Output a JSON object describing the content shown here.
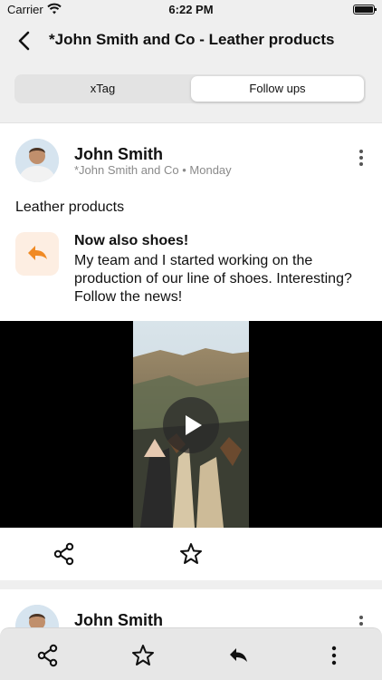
{
  "status_bar": {
    "carrier": "Carrier",
    "time": "6:22 PM"
  },
  "nav": {
    "title": "*John Smith and Co - Leather products"
  },
  "segments": [
    {
      "label": "xTag",
      "selected": false
    },
    {
      "label": "Follow ups",
      "selected": true
    }
  ],
  "post": {
    "author": "John Smith",
    "company": "*John Smith and Co",
    "day": "Monday",
    "topic": "Leather products",
    "message_title": "Now also shoes!",
    "message_body": "My team and I started working on the production of our line of shoes. Interesting? Follow the news!"
  },
  "next_post": {
    "author": "John Smith"
  },
  "icons": {
    "back": "chevron-left-icon",
    "more": "more-vertical-icon",
    "reply": "reply-icon",
    "play": "play-icon",
    "share": "share-icon",
    "star": "star-outline-icon"
  },
  "colors": {
    "accent": "#f08a24",
    "reply_bg": "#fdeee2"
  }
}
